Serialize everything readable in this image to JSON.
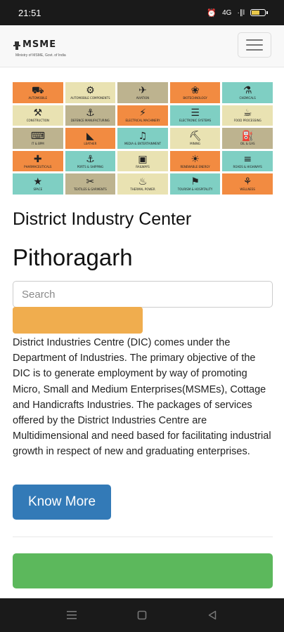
{
  "status_bar": {
    "time": "21:51",
    "network_label": "4G",
    "signal_label": "·∥l",
    "icons": [
      "alarm-icon",
      "network-icon",
      "signal-icon",
      "battery-icon"
    ],
    "battery_level": 0.55
  },
  "header": {
    "logo_wordmark": "MSME",
    "logo_tagline": "Ministry of MSME, Govt. of India",
    "menu_icon": "hamburger-icon"
  },
  "sector_tiles": [
    {
      "label": "Automobile",
      "icon": "⛟",
      "color": "#f28b41"
    },
    {
      "label": "Automobile Components",
      "icon": "⚙",
      "color": "#e9e2b2"
    },
    {
      "label": "Aviation",
      "icon": "✈",
      "color": "#bdb38f"
    },
    {
      "label": "Biotechnology",
      "icon": "❀",
      "color": "#f28b41"
    },
    {
      "label": "Chemicals",
      "icon": "⚗",
      "color": "#7fcfc3"
    },
    {
      "label": "Construction",
      "icon": "⚒",
      "color": "#e9e2b2"
    },
    {
      "label": "Defence Manufacturing",
      "icon": "⚓",
      "color": "#bdb38f"
    },
    {
      "label": "Electrical Machinery",
      "icon": "⚡",
      "color": "#f28b41"
    },
    {
      "label": "Electronic Systems",
      "icon": "☰",
      "color": "#7fcfc3"
    },
    {
      "label": "Food Processing",
      "icon": "☕",
      "color": "#e9e2b2"
    },
    {
      "label": "IT & BPM",
      "icon": "⌨",
      "color": "#bdb38f"
    },
    {
      "label": "Leather",
      "icon": "◣",
      "color": "#f28b41"
    },
    {
      "label": "Media & Entertainment",
      "icon": "♫",
      "color": "#7fcfc3"
    },
    {
      "label": "Mining",
      "icon": "⛏",
      "color": "#e9e2b2"
    },
    {
      "label": "Oil & Gas",
      "icon": "⛽",
      "color": "#bdb38f"
    },
    {
      "label": "Pharmaceuticals",
      "icon": "✚",
      "color": "#f28b41"
    },
    {
      "label": "Ports & Shipping",
      "icon": "⚓",
      "color": "#7fcfc3"
    },
    {
      "label": "Railways",
      "icon": "▣",
      "color": "#e9e2b2"
    },
    {
      "label": "Renewable Energy",
      "icon": "☀",
      "color": "#f28b41"
    },
    {
      "label": "Roads & Highways",
      "icon": "≡",
      "color": "#7fcfc3"
    },
    {
      "label": "Space",
      "icon": "★",
      "color": "#7fcfc3"
    },
    {
      "label": "Textiles & Garments",
      "icon": "✂",
      "color": "#bdb38f"
    },
    {
      "label": "Thermal Power",
      "icon": "♨",
      "color": "#e9e2b2"
    },
    {
      "label": "Tourism & Hospitality",
      "icon": "⚑",
      "color": "#7fcfc3"
    },
    {
      "label": "Wellness",
      "icon": "⚘",
      "color": "#f28b41"
    }
  ],
  "main": {
    "subtitle": "District Industry Center",
    "city": "Pithoragarh",
    "search_placeholder": "Search",
    "description": "District Industries Centre (DIC) comes under the Department of Industries. The primary objective of the DIC is to generate employment by way of promoting Micro, Small and Medium Enterprises(MSMEs), Cottage and Handicrafts Industries. The packages of services offered by the District Industries Centre are Multidimensional and need based for facilitating industrial growth in respect of new and graduating enterprises.",
    "know_more_label": "Know More"
  },
  "colors": {
    "status_bar": "#1a1a1a",
    "orange_button": "#f0ad4e",
    "primary_button": "#337ab7",
    "green_bar": "#5cb85c"
  },
  "nav_buttons": [
    "recents-icon",
    "home-icon",
    "back-icon"
  ]
}
